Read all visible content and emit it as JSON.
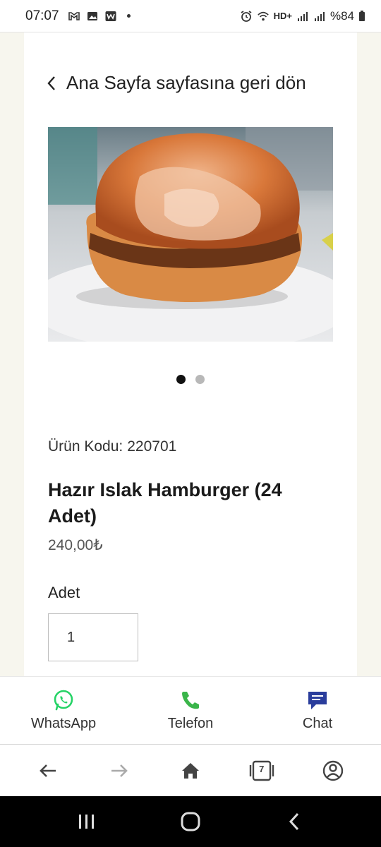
{
  "status_bar": {
    "time": "07:07",
    "battery": "%84",
    "network": "HD+"
  },
  "page": {
    "back_label": "Ana Sayfa sayfasına geri dön",
    "carousel": {
      "count": 2,
      "active_index": 0
    },
    "product": {
      "code_label": "Ürün Kodu:",
      "code": "220701",
      "title": "Hazır Islak Hamburger (24 Adet)",
      "price": "240,00₺",
      "quantity_label": "Adet",
      "quantity_value": "1"
    }
  },
  "contact_bar": {
    "whatsapp_label": "WhatsApp",
    "phone_label": "Telefon",
    "chat_label": "Chat",
    "colors": {
      "whatsapp": "#25d366",
      "phone": "#3ab54a",
      "chat": "#2a3d9c"
    }
  },
  "browser_toolbar": {
    "tab_count": "7"
  }
}
